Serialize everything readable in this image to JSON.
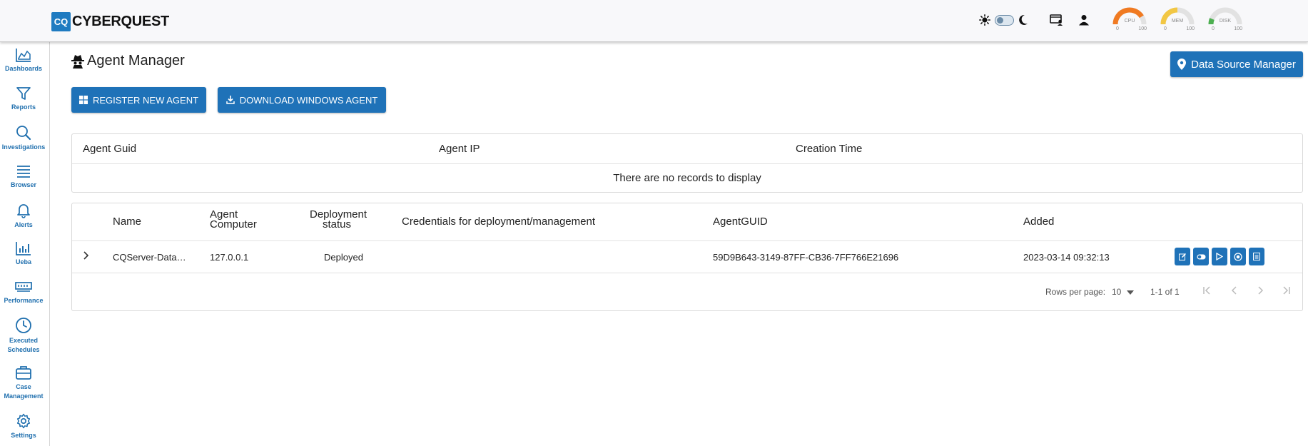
{
  "app": {
    "logo_badge": "CQ",
    "logo_text": "CYBERQUEST"
  },
  "gauges": [
    {
      "label": "CPU",
      "min": "0",
      "max": "100",
      "color": "#f07a22"
    },
    {
      "label": "MEM",
      "min": "0",
      "max": "100",
      "color": "#f2c744"
    },
    {
      "label": "DISK",
      "min": "0",
      "max": "100",
      "color": "#4caf50"
    }
  ],
  "sidebar": {
    "items": [
      {
        "label": "Dashboards",
        "icon": "area-chart-icon"
      },
      {
        "label": "Reports",
        "icon": "filter-icon"
      },
      {
        "label": "Investigations",
        "icon": "search-icon"
      },
      {
        "label": "Browser",
        "icon": "list-icon"
      },
      {
        "label": "Alerts",
        "icon": "bell-icon"
      },
      {
        "label": "Ueba",
        "icon": "bar-chart-icon"
      },
      {
        "label": "Performance",
        "icon": "memory-icon"
      },
      {
        "label": "Executed Schedules",
        "icon": "clock-icon"
      },
      {
        "label": "Case Management",
        "icon": "briefcase-icon"
      },
      {
        "label": "Settings",
        "icon": "gear-icon"
      }
    ]
  },
  "page": {
    "title": "Agent Manager",
    "data_source_button": "Data Source Manager",
    "register_button": "REGISTER NEW AGENT",
    "download_button": "DOWNLOAD WINDOWS AGENT"
  },
  "table1": {
    "columns": [
      "Agent Guid",
      "Agent IP",
      "Creation Time"
    ],
    "empty_text": "There are no records to display"
  },
  "table2": {
    "columns": {
      "name": "Name",
      "agent_computer_1": "Agent",
      "agent_computer_2": "Computer",
      "deployment_1": "Deployment",
      "deployment_2": "status",
      "credentials": "Credentials for deployment/management",
      "agent_guid": "AgentGUID",
      "added": "Added"
    },
    "rows": [
      {
        "name": "CQServer-Data…",
        "computer": "127.0.0.1",
        "status": "Deployed",
        "credentials": "",
        "guid": "59D9B643-3149-87FF-CB36-7FF766E21696",
        "added": "2023-03-14 09:32:13"
      }
    ],
    "pager": {
      "rows_per_page_label": "Rows per page:",
      "rows_per_page_value": "10",
      "range": "1-1 of 1"
    }
  },
  "colors": {
    "accent": "#1f72b8",
    "sidebar_text": "#1f6fae"
  }
}
